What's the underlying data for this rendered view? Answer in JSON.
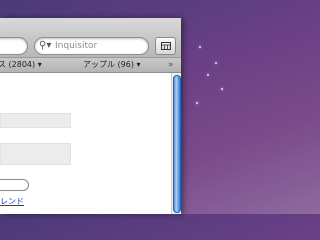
{
  "toolbar": {
    "search": {
      "placeholder": "Inquisitor"
    }
  },
  "bookmarks": {
    "items": [
      {
        "label": "ス (2804)"
      },
      {
        "label": "アップル (96)"
      }
    ],
    "overflow": "»"
  },
  "content": {
    "link_text": "レンド"
  },
  "colors": {
    "accent": "#3a7fd6",
    "link": "#1d3fb8"
  }
}
